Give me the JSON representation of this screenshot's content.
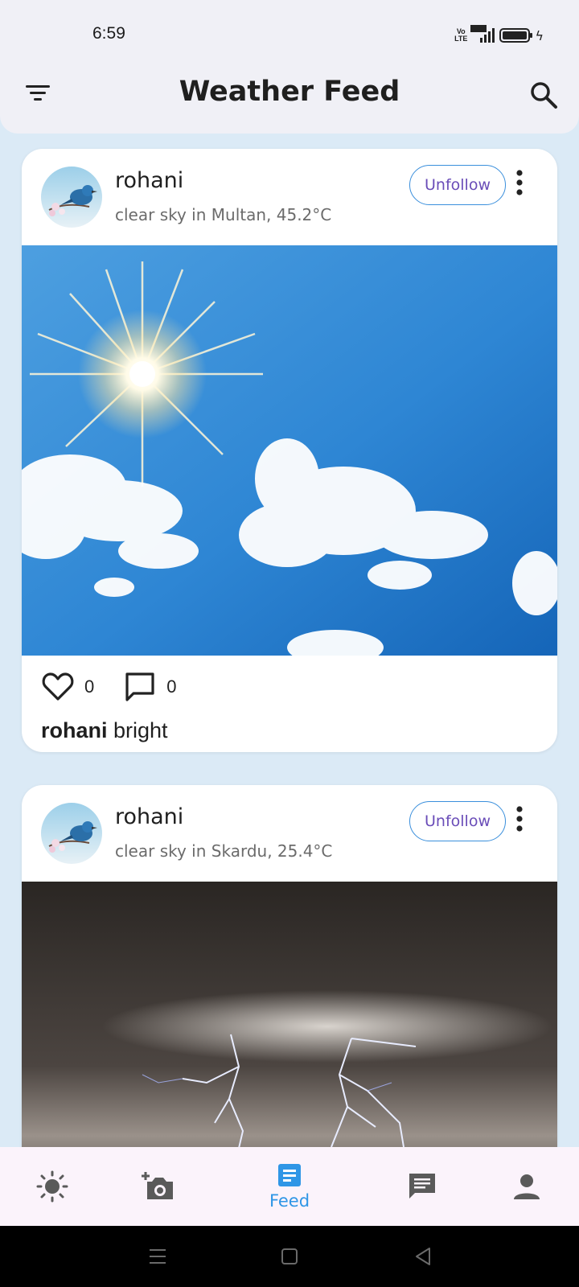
{
  "status_bar": {
    "time": "6:59",
    "network_label": "4G",
    "volte_label": "Vo LTE",
    "icons": [
      "volte-icon",
      "signal-icon",
      "battery-icon",
      "charging-icon"
    ]
  },
  "app_bar": {
    "title": "Weather Feed",
    "left_icon": "filter-list-icon",
    "right_icon": "search-icon"
  },
  "posts": [
    {
      "username": "rohani",
      "subtitle": "clear sky in Multan, 45.2°C",
      "follow_label": "Unfollow",
      "photo": "sunny-sky-with-clouds",
      "likes": "0",
      "comments": "0",
      "caption_user": "rohani",
      "caption_text": " bright"
    },
    {
      "username": "rohani",
      "subtitle": "clear sky in Skardu, 25.4°C",
      "follow_label": "Unfollow",
      "photo": "lightning-storm",
      "likes": "",
      "comments": "",
      "caption_user": "",
      "caption_text": ""
    }
  ],
  "bottom_nav": {
    "items": [
      {
        "icon": "sun-icon",
        "label": ""
      },
      {
        "icon": "add-photo-icon",
        "label": ""
      },
      {
        "icon": "feed-icon",
        "label": "Feed",
        "active": true
      },
      {
        "icon": "chat-icon",
        "label": ""
      },
      {
        "icon": "profile-icon",
        "label": ""
      }
    ]
  },
  "colors": {
    "accent": "#2f96e6",
    "follow_text": "#6a4db8",
    "follow_border": "#3a8fdc",
    "background": "#dbeaf6"
  }
}
